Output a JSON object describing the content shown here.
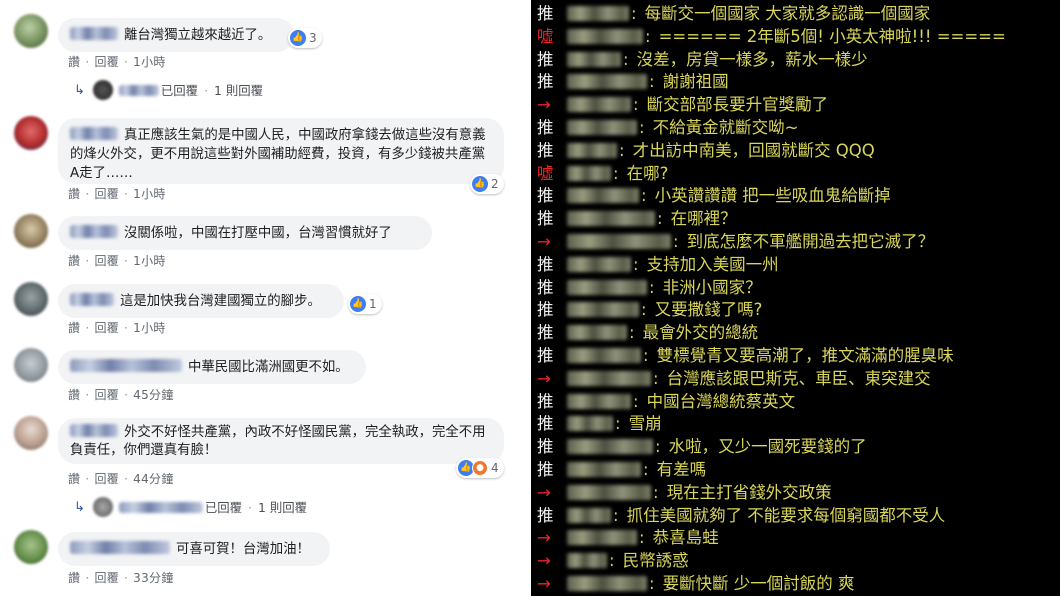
{
  "facebook": {
    "actions": {
      "like": "讚",
      "reply": "回覆",
      "sep": "·"
    },
    "comments": [
      {
        "text": "離台灣獨立越來越近了。",
        "time": "1小時",
        "reactions": "3",
        "reply": {
          "label": "已回覆",
          "count": "1 則回覆"
        }
      },
      {
        "text": "真正應該生氣的是中國人民，中國政府拿錢去做這些沒有意義的烽火外交，更不用說這些對外國補助經費，投資，有多少錢被共產黨A走了……",
        "time": "1小時",
        "reactions": "2"
      },
      {
        "text": "沒關係啦，中國在打壓中國，台灣習慣就好了",
        "time": "1小時"
      },
      {
        "text": "這是加快我台灣建國獨立的腳步。",
        "time": "1小時",
        "reactions": "1"
      },
      {
        "text": "中華民國比滿洲國更不如。",
        "time": "45分鐘"
      },
      {
        "text": "外交不好怪共產黨，內政不好怪國民黨，完全執政，完全不用負責任，你們還真有臉！",
        "time": "44分鐘",
        "reactions": "4",
        "reply": {
          "label": "已回覆",
          "count": "1 則回覆"
        }
      },
      {
        "text": "可喜可賀！台灣加油！",
        "time": "33分鐘"
      }
    ]
  },
  "ptt": {
    "tags": {
      "push": "推",
      "boo": "噓",
      "arrow": "→"
    },
    "colors": {
      "background": "#000000",
      "push": "#f0f0f0",
      "boo": "#e6262b",
      "text": "#d9d65b"
    },
    "rows": [
      {
        "type": "push",
        "text": "每斷交一個國家 大家就多認識一個國家"
      },
      {
        "type": "boo",
        "text": "====== 2年斷5個! 小英太神啦!!! ====="
      },
      {
        "type": "push",
        "text": "沒差，房貸一樣多，薪水一樣少"
      },
      {
        "type": "push",
        "text": "謝謝祖國"
      },
      {
        "type": "arrow",
        "text": "斷交部部長要升官獎勵了"
      },
      {
        "type": "push",
        "text": "不給黃金就斷交呦~"
      },
      {
        "type": "push",
        "text": "才出訪中南美，回國就斷交 QQQ"
      },
      {
        "type": "boo",
        "text": "在哪?"
      },
      {
        "type": "push",
        "text": "小英讚讚讚 把一些吸血鬼給斷掉"
      },
      {
        "type": "push",
        "text": "在哪裡？"
      },
      {
        "type": "arrow",
        "text": "到底怎麼不軍艦開過去把它滅了？"
      },
      {
        "type": "push",
        "text": "支持加入美國一州"
      },
      {
        "type": "push",
        "text": "非洲小國家？"
      },
      {
        "type": "push",
        "text": "又要撒錢了嗎?"
      },
      {
        "type": "push",
        "text": "最會外交的總統"
      },
      {
        "type": "push",
        "text": "雙標覺青又要高潮了，推文滿滿的腥臭味"
      },
      {
        "type": "arrow",
        "text": "台灣應該跟巴斯克、車臣、東突建交"
      },
      {
        "type": "push",
        "text": "中國台灣總統蔡英文"
      },
      {
        "type": "push",
        "text": "雪崩"
      },
      {
        "type": "push",
        "text": "水啦，又少一國死要錢的了"
      },
      {
        "type": "push",
        "text": "有差嗎"
      },
      {
        "type": "arrow",
        "text": "現在主打省錢外交政策"
      },
      {
        "type": "push",
        "text": "抓住美國就夠了 不能要求每個窮國都不受人"
      },
      {
        "type": "arrow",
        "text": "恭喜島蛙"
      },
      {
        "type": "arrow",
        "text": "民幣誘惑"
      },
      {
        "type": "arrow",
        "text": "要斷快斷 少一個討飯的 爽"
      }
    ]
  }
}
